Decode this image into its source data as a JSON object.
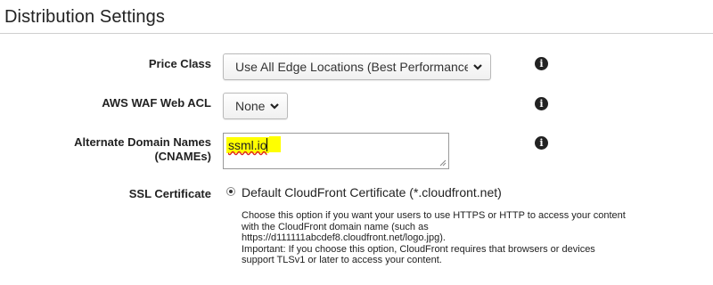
{
  "section": {
    "title": "Distribution Settings"
  },
  "price_class": {
    "label": "Price Class",
    "value": "Use All Edge Locations (Best Performance)"
  },
  "waf": {
    "label": "AWS WAF Web ACL",
    "value": "None"
  },
  "cnames": {
    "label_line1": "Alternate Domain Names",
    "label_line2": "(CNAMEs)",
    "value": "ssml.io"
  },
  "ssl": {
    "label": "SSL Certificate",
    "option_default": {
      "label": "Default CloudFront Certificate (*.cloudfront.net)",
      "selected": true,
      "help_lines": [
        "Choose this option if you want your users to use HTTPS or HTTP to access your content",
        "with the CloudFront domain name (such as",
        "https://d111111abcdef8.cloudfront.net/logo.jpg).",
        "Important: If you choose this option, CloudFront requires that browsers or devices",
        "support TLSv1 or later to access your content."
      ]
    }
  },
  "icons": {
    "info": "info-icon",
    "dropdown": "chevron-down-icon"
  },
  "info_glyph": "i",
  "colors": {
    "highlight": "#ffff00",
    "rule": "#cfcfcf"
  }
}
